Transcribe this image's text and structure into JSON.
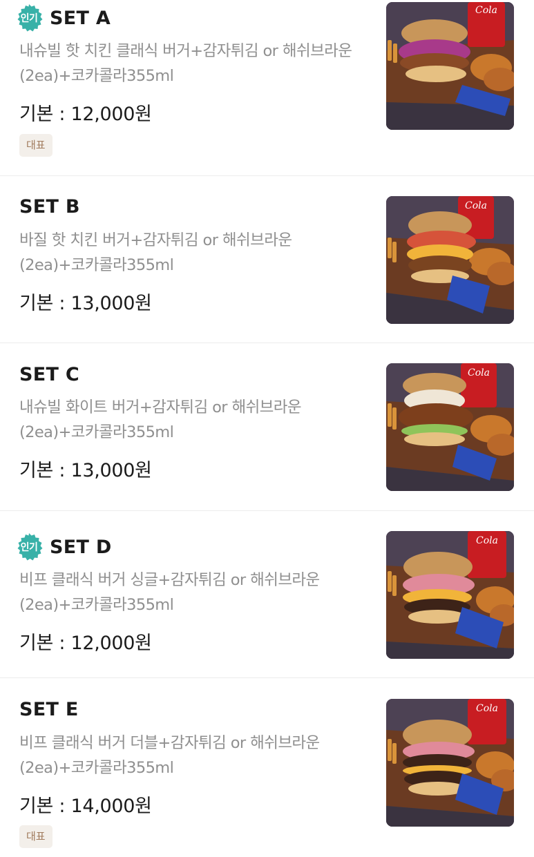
{
  "menu": {
    "popular_badge": "인기",
    "rep_tag": "대표",
    "thumb_icon": "burger-set-photo",
    "items": [
      {
        "name": "SET A",
        "desc": "내슈빌 핫 치킨 클래식 버거+감자튀김 or 해쉬브라운(2ea)+코카콜라355ml",
        "price": "기본 : 12,000원",
        "popular": true,
        "rep": true
      },
      {
        "name": "SET B",
        "desc": "바질 핫 치킨 버거+감자튀김 or 해쉬브라운(2ea)+코카콜라355ml",
        "price": "기본 : 13,000원",
        "popular": false,
        "rep": false
      },
      {
        "name": "SET C",
        "desc": "내슈빌 화이트 버거+감자튀김 or 해쉬브라운(2ea)+코카콜라355ml",
        "price": "기본 : 13,000원",
        "popular": false,
        "rep": false
      },
      {
        "name": "SET D",
        "desc": "비프 클래식 버거 싱글+감자튀김 or 해쉬브라운(2ea)+코카콜라355ml",
        "price": "기본 : 12,000원",
        "popular": true,
        "rep": false
      },
      {
        "name": "SET E",
        "desc": "비프 클래식 버거 더블+감자튀김 or 해쉬브라운(2ea)+코카콜라355ml",
        "price": "기본 : 14,000원",
        "popular": false,
        "rep": true
      }
    ]
  }
}
